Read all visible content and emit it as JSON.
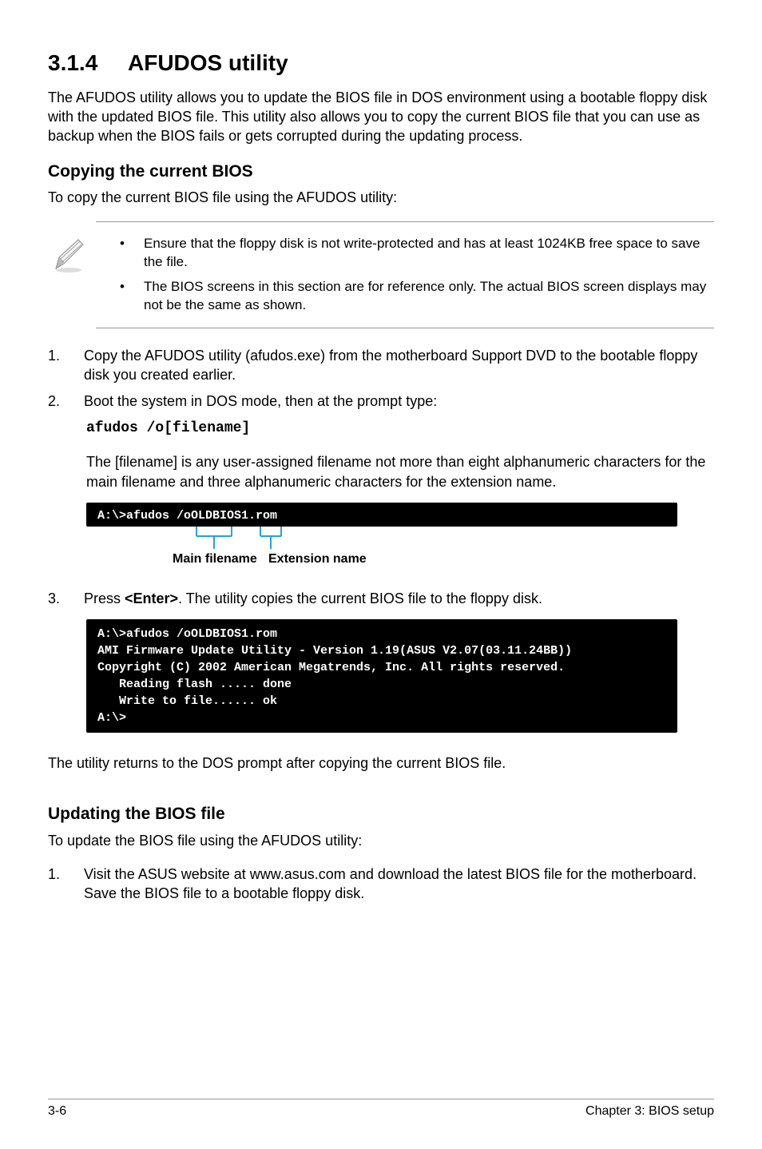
{
  "section": {
    "number": "3.1.4",
    "title": "AFUDOS utility",
    "intro": "The AFUDOS utility allows you to update the BIOS file in DOS environment using a bootable floppy disk with the updated BIOS file. This utility also allows you to copy the current BIOS file that you can use as backup when the BIOS fails or gets corrupted during the updating process."
  },
  "copying": {
    "heading": "Copying the current BIOS",
    "lead": "To copy the current BIOS file using the AFUDOS utility:",
    "notes": [
      "Ensure that the floppy disk is not write-protected and has at least 1024KB free space to save the file.",
      "The BIOS screens in this section are for reference only. The actual BIOS screen displays may not be the same as shown."
    ],
    "steps": [
      {
        "n": "1.",
        "t": "Copy the AFUDOS utility (afudos.exe) from the motherboard Support DVD to the bootable floppy disk you created earlier."
      },
      {
        "n": "2.",
        "t": "Boot the system in DOS mode, then at the prompt type:"
      }
    ],
    "cmd": "afudos /o[filename]",
    "after_cmd": "The [filename] is any user-assigned filename not more than eight alphanumeric characters  for the main filename and three alphanumeric characters for the extension name.",
    "terminal1": "A:\\>afudos /oOLDBIOS1.rom",
    "anno_main": "Main filename",
    "anno_ext": "Extension name",
    "step3_n": "3.",
    "step3_pre": "Press ",
    "step3_key": "<Enter>",
    "step3_post": ". The utility copies the current BIOS file to the floppy disk.",
    "terminal2": "A:\\>afudos /oOLDBIOS1.rom\nAMI Firmware Update Utility - Version 1.19(ASUS V2.07(03.11.24BB))\nCopyright (C) 2002 American Megatrends, Inc. All rights reserved.\n   Reading flash ..... done\n   Write to file...... ok\nA:\\>",
    "closing": "The utility returns to the DOS prompt after copying the current BIOS file."
  },
  "updating": {
    "heading": "Updating the BIOS file",
    "lead": "To update the BIOS file using the AFUDOS utility:",
    "steps": [
      {
        "n": "1.",
        "t": "Visit the ASUS website at www.asus.com and download the latest BIOS file for the motherboard. Save the BIOS file to a bootable floppy disk."
      }
    ]
  },
  "footer": {
    "left": "3-6",
    "right": "Chapter 3: BIOS setup"
  }
}
